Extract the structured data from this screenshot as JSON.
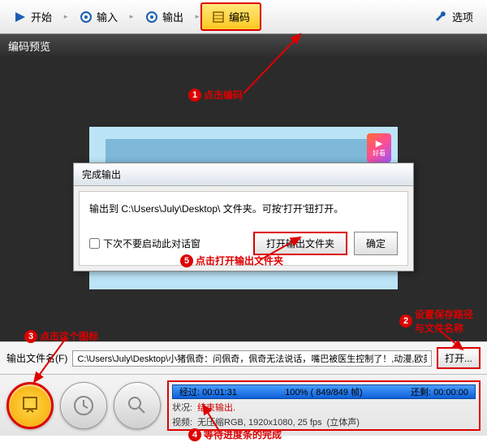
{
  "toolbar": {
    "start": "开始",
    "input": "输入",
    "output": "输出",
    "encode": "编码",
    "options": "选项"
  },
  "preview": {
    "title": "编码预览",
    "logo_text": "好看"
  },
  "dialog": {
    "title": "完成输出",
    "message": "输出到 C:\\Users\\July\\Desktop\\ 文件夹。可按'打开'钮打开。",
    "checkbox": "下次不要启动此对话窗",
    "open_folder": "打开输出文件夹",
    "ok": "确定"
  },
  "output": {
    "label": "输出文件名(F)",
    "path": "C:\\Users\\July\\Desktop\\小猪佩奇：问佩奇，佩奇无法说话，嘴巴被医生控制了！,动漫,欧美动漫,好看视",
    "open": "打开..."
  },
  "status": {
    "elapsed_label": "经过:",
    "elapsed": "00:01:31",
    "percent": "100%",
    "frames": "( 849/849 帧)",
    "remain_label": "还剩:",
    "remain": "00:00:00",
    "line1_a": "状况:",
    "line1_b": "结束输出.",
    "line2_a": "视频:",
    "line2_b": "无压缩RGB, 1920x1080, 25 fps",
    "line2_c": "(立体声)"
  },
  "annotations": {
    "a1": "点击编码",
    "a2": "设置保存路径\n与文件名称",
    "a3": "点击这个图标",
    "a4": "等待进度条的完成",
    "a5": "点击打开输出文件夹"
  }
}
